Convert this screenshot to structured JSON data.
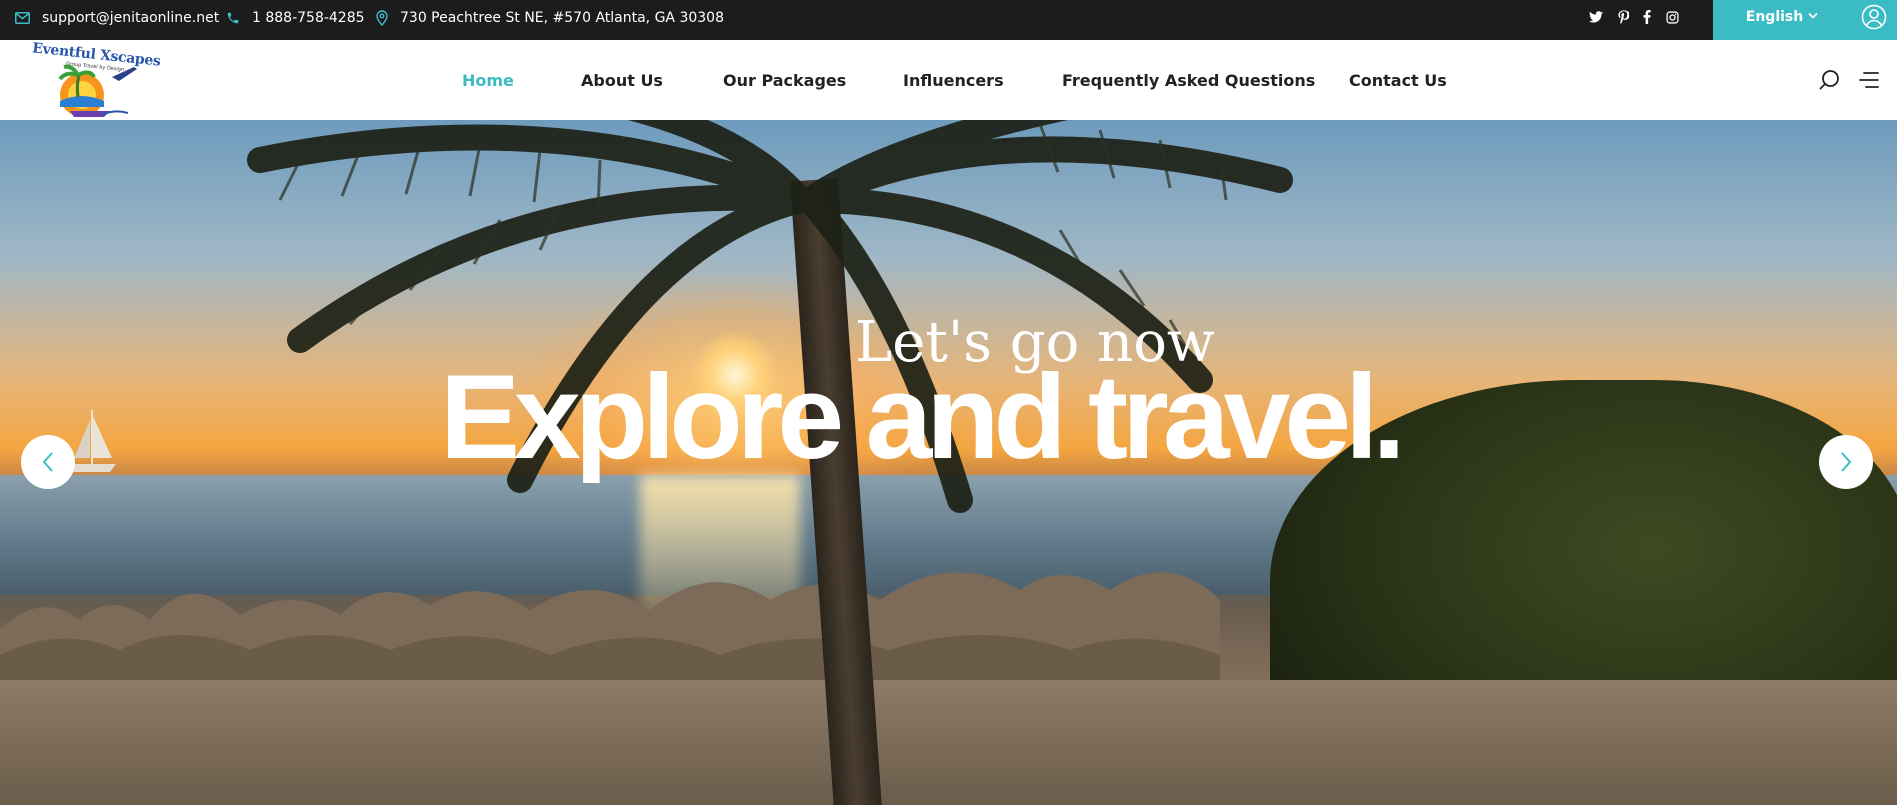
{
  "topbar": {
    "email": "support@jenitaonline.net",
    "phone": "1 888-758-4285",
    "address": "730 Peachtree St NE, #570 Atlanta, GA 30308",
    "social_icons": [
      "twitter-icon",
      "pinterest-icon",
      "facebook-icon",
      "instagram-icon"
    ],
    "language": "English",
    "colors": {
      "background": "#1c1c1c",
      "accent": "#3bbcc4"
    }
  },
  "logo": {
    "text": "Eventful Xscapes",
    "tagline": "Group Travel by Design"
  },
  "nav": {
    "items": [
      {
        "label": "Home",
        "active": true
      },
      {
        "label": "About Us",
        "active": false
      },
      {
        "label": "Our Packages",
        "active": false
      },
      {
        "label": "Influencers",
        "active": false
      },
      {
        "label": "Frequently Asked Questions",
        "active": false
      },
      {
        "label": "Contact Us",
        "active": false
      }
    ],
    "icons": [
      "search-icon",
      "menu-icon"
    ]
  },
  "hero": {
    "kicker": "Let's go now",
    "title": "Explore and travel.",
    "controls": [
      "chevron-left-icon",
      "chevron-right-icon"
    ]
  }
}
